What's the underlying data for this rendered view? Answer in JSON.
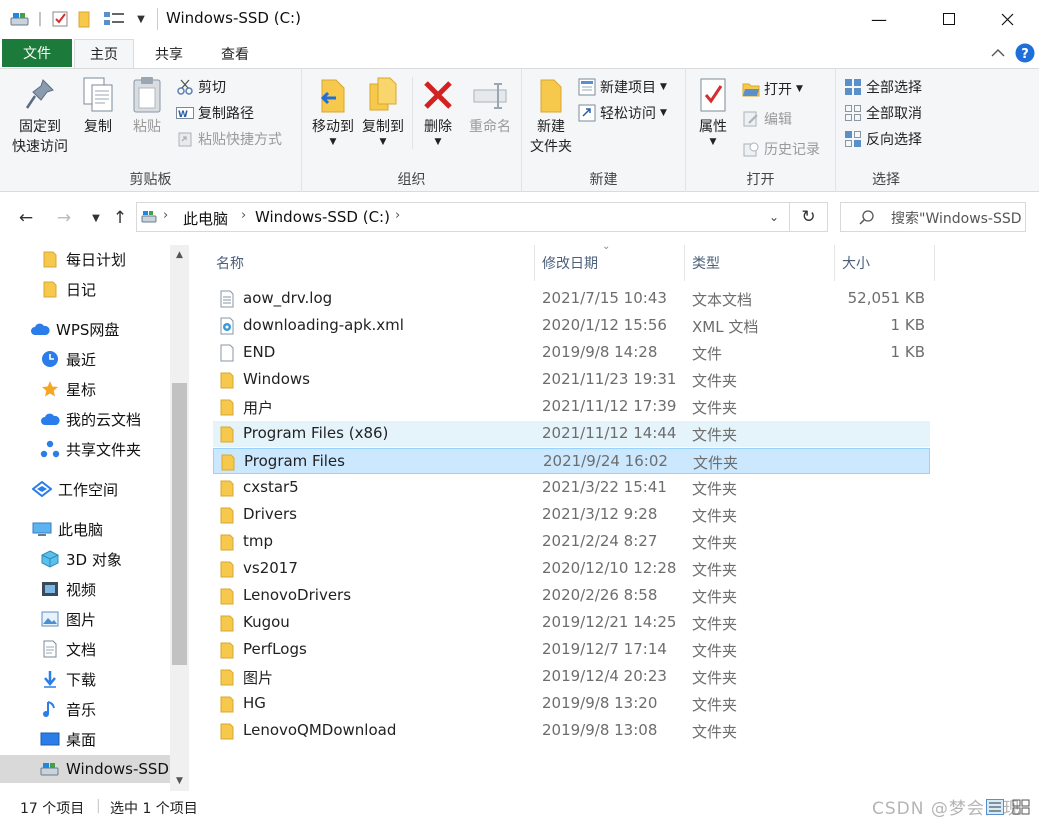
{
  "window": {
    "title": "Windows-SSD (C:)",
    "minimize_icon": "minimize-icon",
    "maximize_icon": "maximize-icon",
    "close_icon": "close-icon"
  },
  "ribbon": {
    "tabs": {
      "file": "文件",
      "home": "主页",
      "share": "共享",
      "view": "查看"
    },
    "clipboard": {
      "label": "剪贴板",
      "pin": "固定到\n快速访问",
      "pin_l1": "固定到",
      "pin_l2": "快速访问",
      "copy": "复制",
      "paste": "粘贴",
      "cut": "剪切",
      "copy_path": "复制路径",
      "paste_shortcut": "粘贴快捷方式"
    },
    "organize": {
      "label": "组织",
      "move_to": "移动到",
      "copy_to": "复制到",
      "delete": "删除",
      "rename": "重命名"
    },
    "new": {
      "label": "新建",
      "new_folder_l1": "新建",
      "new_folder_l2": "文件夹",
      "new_item": "新建项目",
      "easy_access": "轻松访问"
    },
    "open": {
      "label": "打开",
      "properties": "属性",
      "open": "打开",
      "edit": "编辑",
      "history": "历史记录"
    },
    "select": {
      "label": "选择",
      "select_all": "全部选择",
      "select_none": "全部取消",
      "invert": "反向选择"
    }
  },
  "address": {
    "crumbs": [
      "此电脑",
      "Windows-SSD (C:)"
    ],
    "search_placeholder": "搜索\"Windows-SSD (C:)\""
  },
  "nav": {
    "items": [
      {
        "label": "每日计划",
        "icon": "folder-icon"
      },
      {
        "label": "日记",
        "icon": "folder-icon"
      },
      {
        "label": "WPS网盘",
        "icon": "cloud-icon"
      },
      {
        "label": "最近",
        "icon": "clock-icon"
      },
      {
        "label": "星标",
        "icon": "star-icon"
      },
      {
        "label": "我的云文档",
        "icon": "cloud-icon"
      },
      {
        "label": "共享文件夹",
        "icon": "share-icon"
      },
      {
        "label": "工作空间",
        "icon": "workspace-icon"
      },
      {
        "label": "此电脑",
        "icon": "computer-icon"
      },
      {
        "label": "3D 对象",
        "icon": "cube-icon"
      },
      {
        "label": "视频",
        "icon": "video-icon"
      },
      {
        "label": "图片",
        "icon": "picture-icon"
      },
      {
        "label": "文档",
        "icon": "document-icon"
      },
      {
        "label": "下载",
        "icon": "download-icon"
      },
      {
        "label": "音乐",
        "icon": "music-icon"
      },
      {
        "label": "桌面",
        "icon": "desktop-icon"
      },
      {
        "label": "Windows-SSD",
        "icon": "drive-icon"
      }
    ]
  },
  "filelist": {
    "columns": {
      "name": "名称",
      "modified": "修改日期",
      "type": "类型",
      "size": "大小"
    },
    "rows": [
      {
        "name": "aow_drv.log",
        "modified": "2021/7/15 10:43",
        "type": "文本文档",
        "size": "52,051 KB",
        "icon": "text-file-icon"
      },
      {
        "name": "downloading-apk.xml",
        "modified": "2020/1/12 15:56",
        "type": "XML 文档",
        "size": "1 KB",
        "icon": "xml-file-icon"
      },
      {
        "name": "END",
        "modified": "2019/9/8 14:28",
        "type": "文件",
        "size": "1 KB",
        "icon": "file-icon"
      },
      {
        "name": "Windows",
        "modified": "2021/11/23 19:31",
        "type": "文件夹",
        "size": "",
        "icon": "folder-icon"
      },
      {
        "name": "用户",
        "modified": "2021/11/12 17:39",
        "type": "文件夹",
        "size": "",
        "icon": "folder-icon"
      },
      {
        "name": "Program Files (x86)",
        "modified": "2021/11/12 14:44",
        "type": "文件夹",
        "size": "",
        "icon": "folder-icon"
      },
      {
        "name": "Program Files",
        "modified": "2021/9/24 16:02",
        "type": "文件夹",
        "size": "",
        "icon": "folder-icon"
      },
      {
        "name": "cxstar5",
        "modified": "2021/3/22 15:41",
        "type": "文件夹",
        "size": "",
        "icon": "folder-icon"
      },
      {
        "name": "Drivers",
        "modified": "2021/3/12 9:28",
        "type": "文件夹",
        "size": "",
        "icon": "folder-icon"
      },
      {
        "name": "tmp",
        "modified": "2021/2/24 8:27",
        "type": "文件夹",
        "size": "",
        "icon": "folder-icon"
      },
      {
        "name": "vs2017",
        "modified": "2020/12/10 12:28",
        "type": "文件夹",
        "size": "",
        "icon": "folder-icon"
      },
      {
        "name": "LenovoDrivers",
        "modified": "2020/2/26 8:58",
        "type": "文件夹",
        "size": "",
        "icon": "folder-icon"
      },
      {
        "name": "Kugou",
        "modified": "2019/12/21 14:25",
        "type": "文件夹",
        "size": "",
        "icon": "folder-icon"
      },
      {
        "name": "PerfLogs",
        "modified": "2019/12/7 17:14",
        "type": "文件夹",
        "size": "",
        "icon": "folder-icon"
      },
      {
        "name": "图片",
        "modified": "2019/12/4 20:23",
        "type": "文件夹",
        "size": "",
        "icon": "folder-icon"
      },
      {
        "name": "HG",
        "modified": "2019/9/8 13:20",
        "type": "文件夹",
        "size": "",
        "icon": "folder-icon"
      },
      {
        "name": "LenovoQMDownload",
        "modified": "2019/9/8 13:08",
        "type": "文件夹",
        "size": "",
        "icon": "folder-icon"
      }
    ]
  },
  "status": {
    "count": "17 个项目",
    "selected": "选中 1 个项目",
    "watermark": "CSDN @梦会实现"
  },
  "colors": {
    "file_tab": "#1c7a3a",
    "selected_row": "#cce8ff",
    "hover_row": "#e5f3fb",
    "folder": "#f6c94c"
  }
}
